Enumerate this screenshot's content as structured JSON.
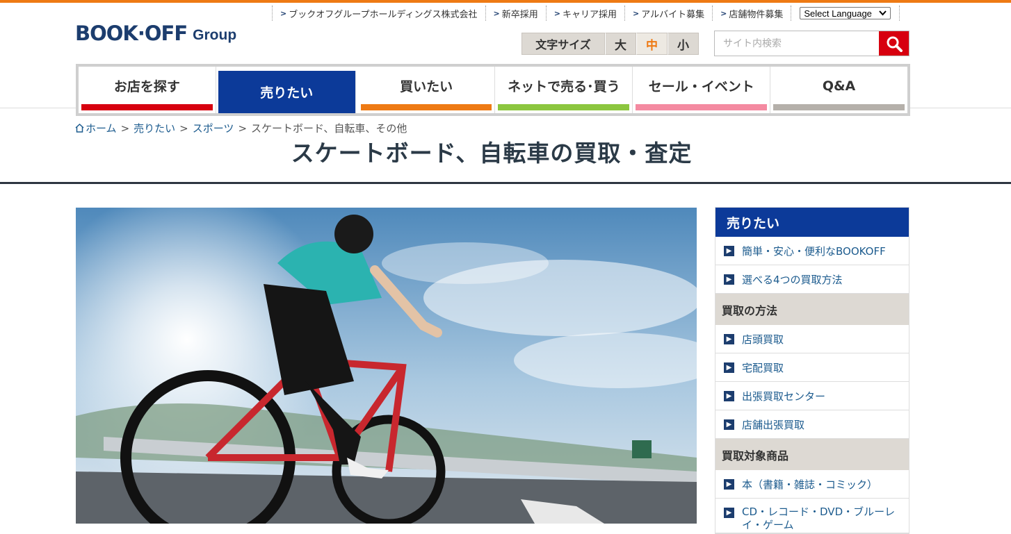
{
  "brand": {
    "logo": "BOOK·OFF",
    "sub": "Group"
  },
  "util_nav": [
    "ブックオフグループホールディングス株式会社",
    "新卒採用",
    "キャリア採用",
    "アルバイト募集",
    "店舗物件募集"
  ],
  "language": {
    "label": "Select Language"
  },
  "font_size": {
    "label": "文字サイズ",
    "large": "大",
    "medium": "中",
    "small": "小",
    "selected": "中"
  },
  "search": {
    "placeholder": "サイト内検索"
  },
  "global_nav": [
    {
      "label": "お店を探す",
      "color": "#d7000f"
    },
    {
      "label": "売りたい",
      "color": "#0c3a99"
    },
    {
      "label": "買いたい",
      "color": "#ee7a14"
    },
    {
      "label": "ネットで売る･買う",
      "color": "#8cc63f"
    },
    {
      "label": "セール・イベント",
      "color": "#f48aa1"
    },
    {
      "label": "Q&A",
      "color": "#b5b0aa"
    }
  ],
  "breadcrumb": {
    "home": "ホーム",
    "items": [
      "売りたい",
      "スポーツ"
    ],
    "current": "スケートボード、自転車、その他"
  },
  "page_title": "スケートボード、自転車の買取・査定",
  "sidebar": {
    "heading": "売りたい",
    "intro_links": [
      "簡単・安心・便利なBOOKOFF",
      "選べる4つの買取方法"
    ],
    "section1": {
      "title": "買取の方法",
      "links": [
        "店頭買取",
        "宅配買取",
        "出張買取センター",
        "店舗出張買取"
      ]
    },
    "section2": {
      "title": "買取対象商品",
      "links": [
        "本（書籍・雑誌・コミック）",
        "CD・レコード・DVD・ブルーレイ・ゲーム"
      ]
    }
  },
  "colors": {
    "accent_orange": "#ee7a14",
    "brand_navy": "#1c3d6e",
    "nav_active": "#0c3a99",
    "search_red": "#d7000f"
  }
}
